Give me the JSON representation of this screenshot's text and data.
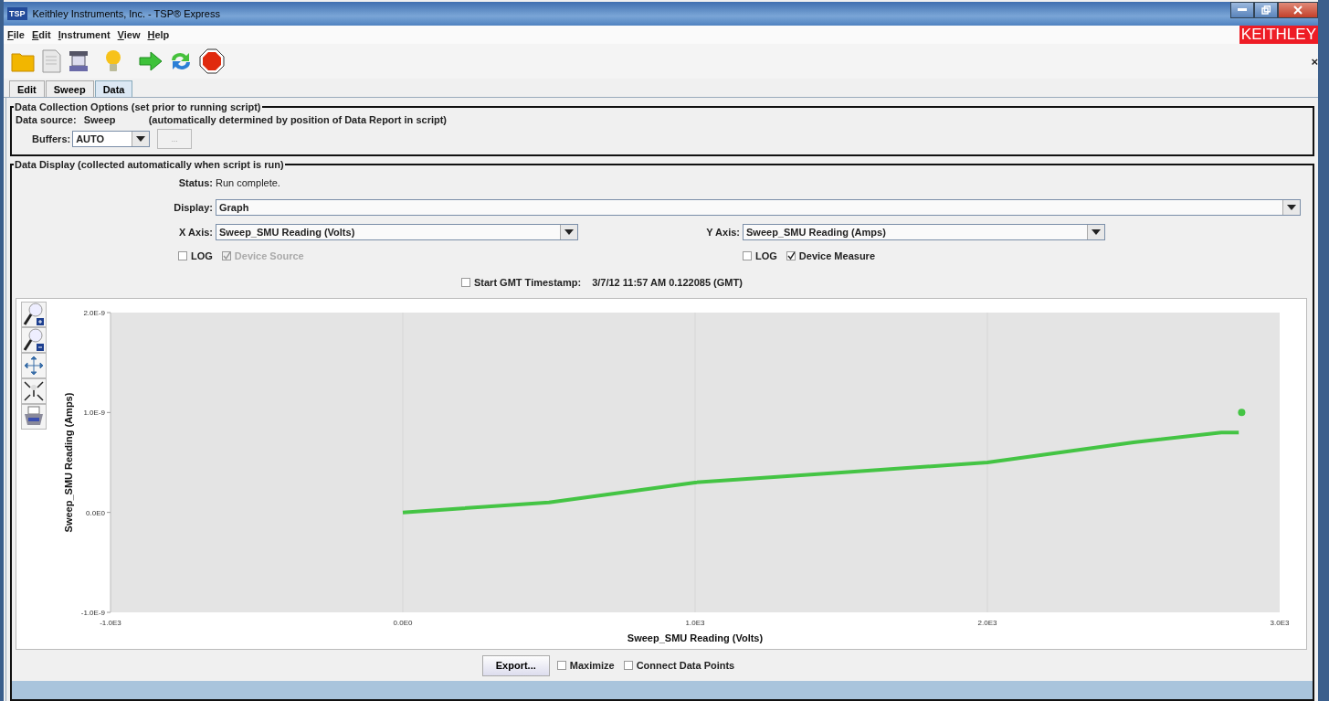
{
  "window": {
    "title": "Keithley Instruments, Inc. - TSP® Express",
    "icon_text": "TSP"
  },
  "menu": [
    "File",
    "Edit",
    "Instrument",
    "View",
    "Help"
  ],
  "brand": "KEITHLEY",
  "toolbar": {
    "close": "×"
  },
  "tabs": [
    {
      "label": "Edit",
      "selected": false
    },
    {
      "label": "Sweep",
      "selected": false
    },
    {
      "label": "Data",
      "selected": true
    }
  ],
  "collection": {
    "legend": "Data Collection Options (set prior to running script)",
    "source_label": "Data source:",
    "source_value": "Sweep",
    "source_note": "(automatically determined by position of Data Report in script)",
    "buffers_label": "Buffers:",
    "buffers_value": "AUTO",
    "more_button": "..."
  },
  "display": {
    "legend": "Data Display (collected automatically when script is run)",
    "status_label": "Status:",
    "status_value": "Run complete.",
    "display_label": "Display:",
    "display_value": "Graph",
    "x_axis": {
      "label": "X Axis:",
      "value": "Sweep_SMU Reading (Volts)",
      "log": {
        "label": "LOG",
        "checked": false,
        "disabled": false
      },
      "device": {
        "label": "Device Source",
        "checked": true,
        "disabled": true
      }
    },
    "y_axis": {
      "label": "Y Axis:",
      "value": "Sweep_SMU Reading (Amps)",
      "log": {
        "label": "LOG",
        "checked": false,
        "disabled": false
      },
      "device": {
        "label": "Device Measure",
        "checked": true,
        "disabled": false
      }
    },
    "timestamp": {
      "label": "Start GMT Timestamp:",
      "value": "3/7/12 11:57 AM 0.122085 (GMT)",
      "checked": false
    }
  },
  "chart_data": {
    "type": "line",
    "xlabel": "Sweep_SMU Reading (Volts)",
    "ylabel": "Sweep_SMU Reading (Amps)",
    "x": [
      0,
      500,
      1000,
      1500,
      2000,
      2500,
      2800,
      2860,
      2870
    ],
    "series": [
      {
        "color": "#44c444",
        "values": [
          0,
          1e-10,
          3e-10,
          4e-10,
          5e-10,
          7e-10,
          8e-10,
          8e-10,
          null
        ]
      },
      {
        "color": "#44c444",
        "marker": true,
        "values": [
          null,
          null,
          null,
          null,
          null,
          null,
          null,
          null,
          1e-09
        ]
      }
    ],
    "grid": true,
    "xlim": [
      -1000,
      3000
    ],
    "ylim": [
      -1e-09,
      2e-09
    ],
    "xticks": [
      {
        "value": -1000,
        "label": "-1.0E3"
      },
      {
        "value": 0,
        "label": "0.0E0"
      },
      {
        "value": 1000,
        "label": "1.0E3"
      },
      {
        "value": 2000,
        "label": "2.0E3"
      },
      {
        "value": 3000,
        "label": "3.0E3"
      }
    ],
    "yticks": [
      {
        "value": -1e-09,
        "label": "-1.0E-9"
      },
      {
        "value": 0,
        "label": "0.0E0"
      },
      {
        "value": 1e-09,
        "label": "1.0E-9"
      },
      {
        "value": 2e-09,
        "label": "2.0E-9"
      }
    ]
  },
  "bottom": {
    "export": "Export...",
    "options": [
      {
        "label": "Maximize",
        "checked": false
      },
      {
        "label": "Connect Data Points",
        "checked": false
      }
    ]
  }
}
